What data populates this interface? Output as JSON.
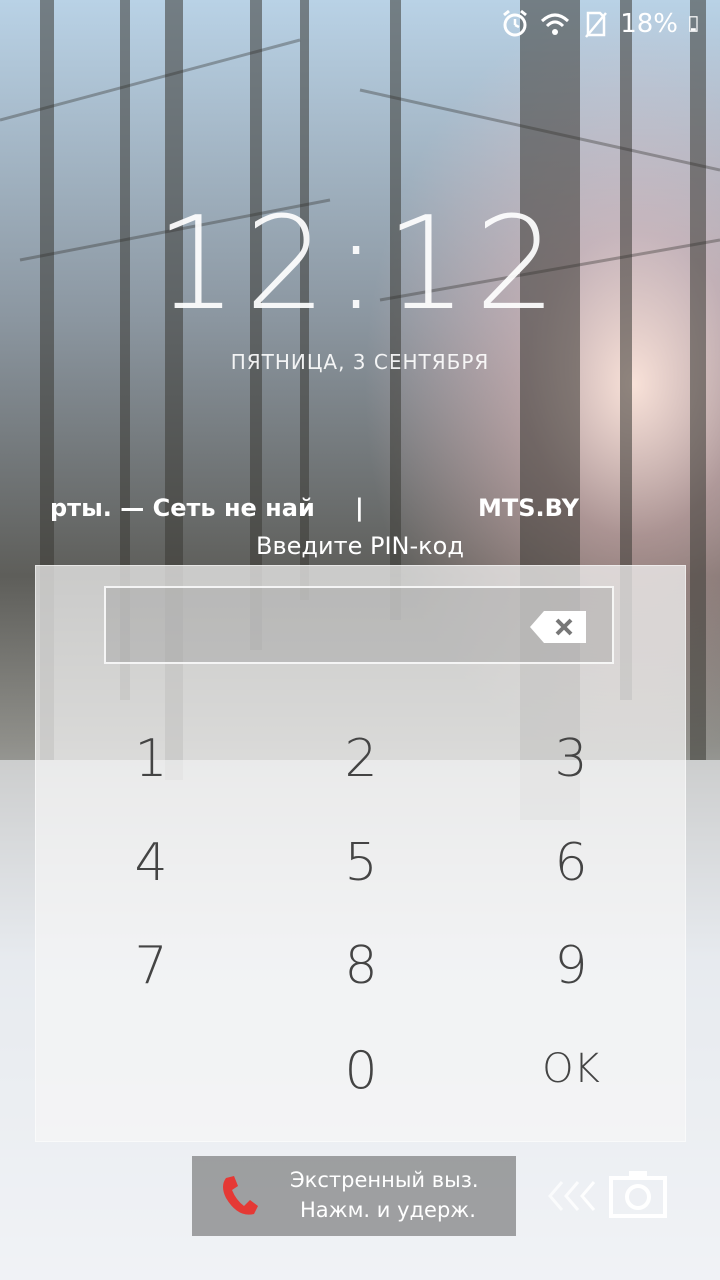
{
  "status_bar": {
    "battery": "18%",
    "icons": [
      "alarm-icon",
      "wifi-icon",
      "no-sim-icon",
      "battery-icon"
    ]
  },
  "lockscreen": {
    "time": "12:12",
    "date": "ПЯТНИЦА, 3 СЕНТЯБРЯ",
    "carrier_ticker_left": "рты. — Сеть не най",
    "carrier_ticker_separator": "|",
    "carrier_ticker_right": "MTS.BY",
    "pin_prompt": "Введите PIN-код"
  },
  "keypad": {
    "keys": [
      "1",
      "2",
      "3",
      "4",
      "5",
      "6",
      "7",
      "8",
      "9",
      "0",
      "OK"
    ]
  },
  "emergency": {
    "line1": "Экстренный выз.",
    "line2": "Нажм. и удерж."
  },
  "colors": {
    "phone_icon": "#e53935",
    "key_text": "#444444"
  }
}
